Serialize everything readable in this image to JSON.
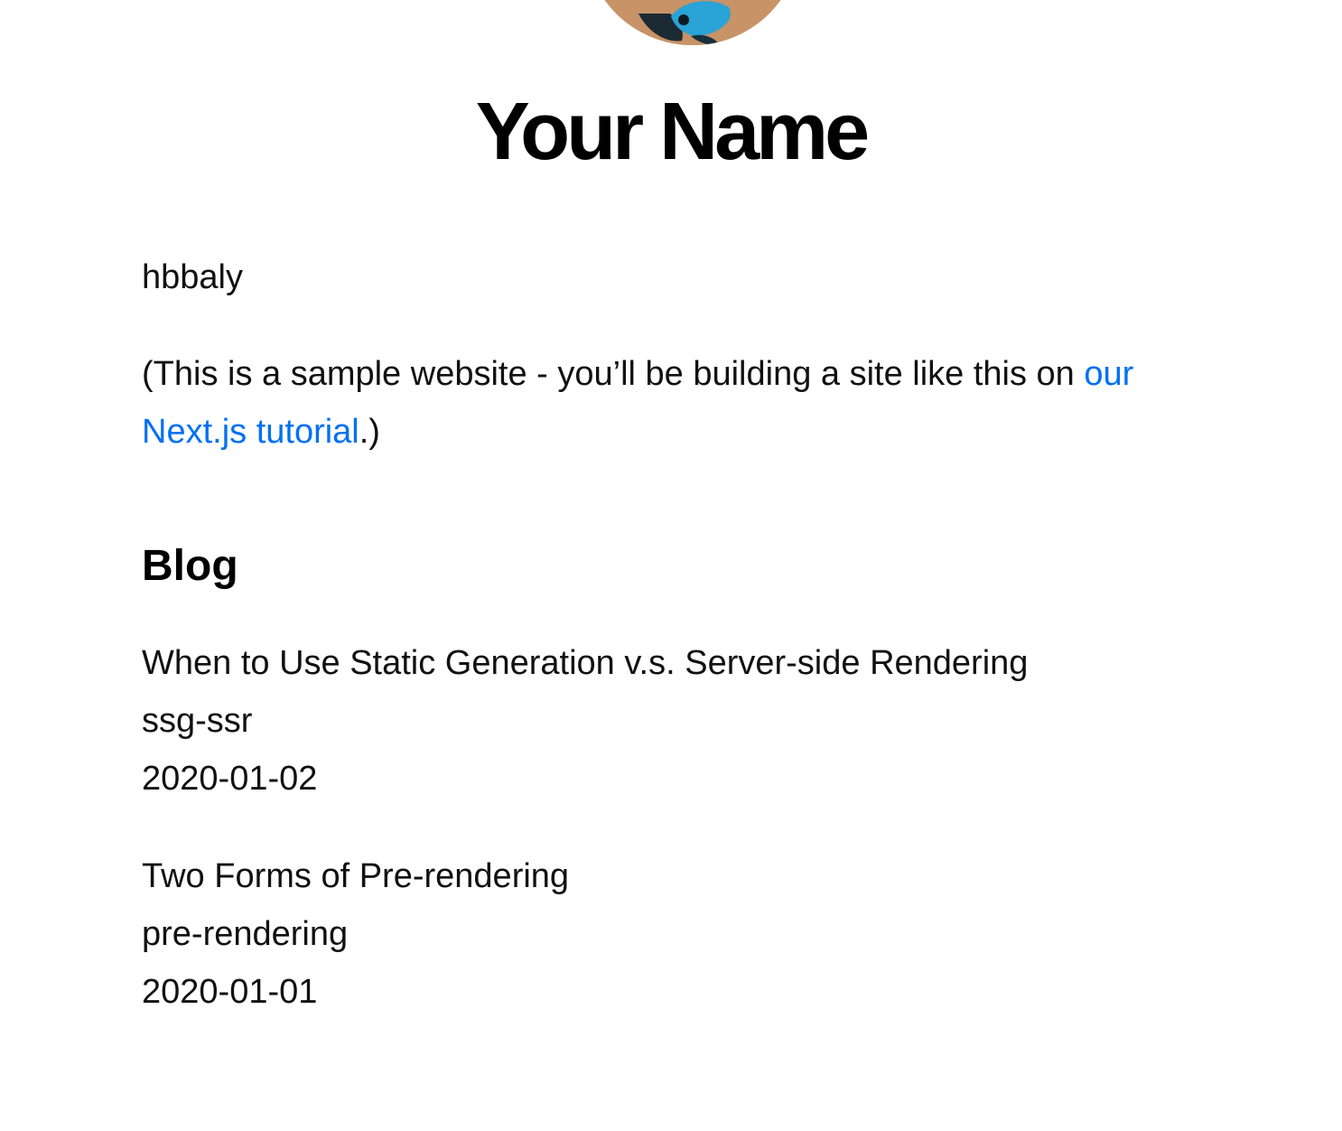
{
  "header": {
    "name": "Your Name"
  },
  "intro": {
    "text": "hbbaly",
    "note_prefix": "(This is a sample website - you’ll be building a site like this on ",
    "note_link": "our Next.js tutorial",
    "note_suffix": ".)"
  },
  "blog": {
    "heading": "Blog",
    "posts": [
      {
        "title": "When to Use Static Generation v.s. Server-side Rendering",
        "id": "ssg-ssr",
        "date": "2020-01-02"
      },
      {
        "title": "Two Forms of Pre-rendering",
        "id": "pre-rendering",
        "date": "2020-01-01"
      }
    ]
  },
  "colors": {
    "link": "#0070f3",
    "text": "#111111"
  }
}
